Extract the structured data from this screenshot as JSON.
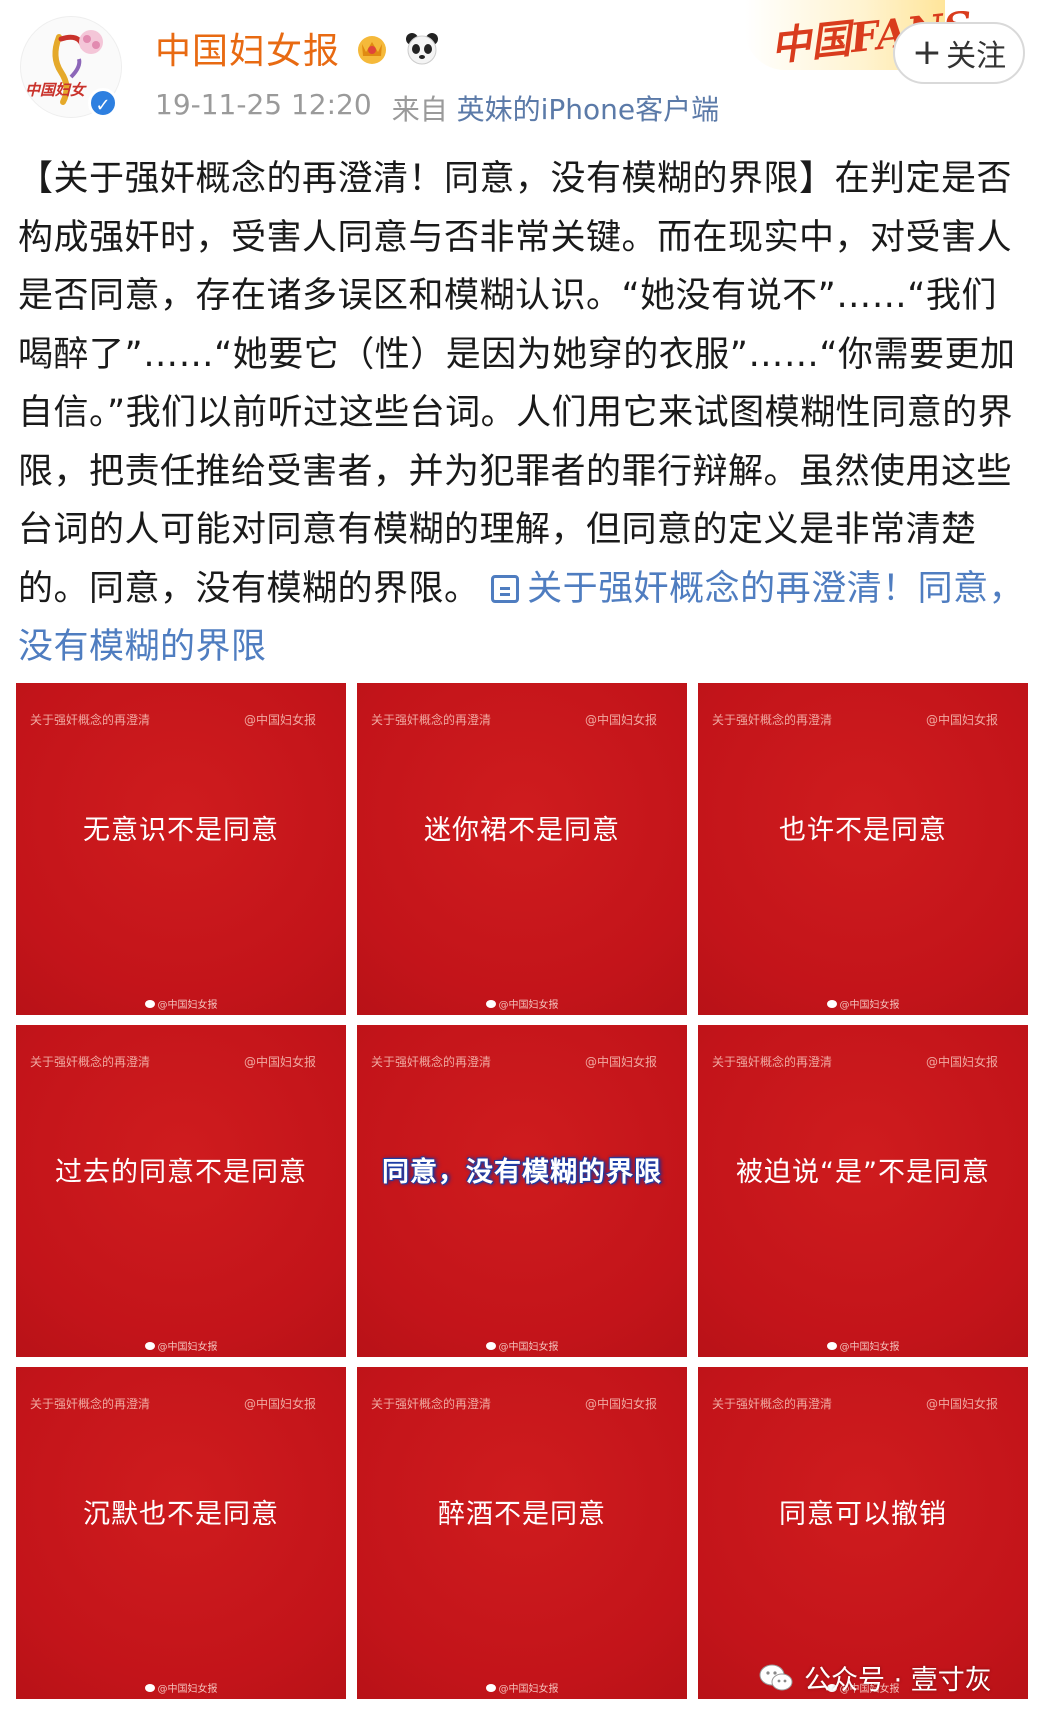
{
  "header": {
    "user_name": "中国妇女报",
    "timestamp": "19-11-25 12:20",
    "source_prefix": "来自",
    "source_app": "英妹的iPhone客户端",
    "follow_label": "关注",
    "follow_plus": "+",
    "fans_banner_text": "中国FANS",
    "avatar_text": "中国妇女",
    "verified_mark": "✓"
  },
  "post": {
    "text_main": "【关于强奸概念的再澄清！同意，没有模糊的界限】在判定是否构成强奸时，受害人同意与否非常关键。而在现实中，对受害人是否同意，存在诸多误区和模糊认识。“她没有说不”……“我们喝醉了”……“她要它（性）是因为她穿的衣服”……“你需要更加自信。”我们以前听过这些台词。人们用它来试图模糊性同意的界限，把责任推给受害者，并为犯罪者的罪行辩解。虽然使用这些台词的人可能对同意有模糊的理解，但同意的定义是非常清楚的。同意，没有模糊的界限。",
    "topic_link": "关于强奸概念的再澄清！同意，没有模糊的界限"
  },
  "tiles": [
    {
      "top_left": "关于强奸概念的再澄清",
      "top_right": "@中国妇女报",
      "main": "无意识不是同意",
      "bottom": "@中国妇女报"
    },
    {
      "top_left": "关于强奸概念的再澄清",
      "top_right": "@中国妇女报",
      "main": "迷你裙不是同意",
      "bottom": "@中国妇女报"
    },
    {
      "top_left": "关于强奸概念的再澄清",
      "top_right": "@中国妇女报",
      "main": "也许不是同意",
      "bottom": "@中国妇女报"
    },
    {
      "top_left": "关于强奸概念的再澄清",
      "top_right": "@中国妇女报",
      "main": "过去的同意不是同意",
      "bottom": "@中国妇女报"
    },
    {
      "top_left": "关于强奸概念的再澄清",
      "top_right": "@中国妇女报",
      "main": "同意，没有模糊的界限",
      "bottom": "@中国妇女报"
    },
    {
      "top_left": "关于强奸概念的再澄清",
      "top_right": "@中国妇女报",
      "main": "被迫说“是”不是同意",
      "bottom": "@中国妇女报"
    },
    {
      "top_left": "关于强奸概念的再澄清",
      "top_right": "@中国妇女报",
      "main": "沉默也不是同意",
      "bottom": "@中国妇女报"
    },
    {
      "top_left": "关于强奸概念的再澄清",
      "top_right": "@中国妇女报",
      "main": "醉酒不是同意",
      "bottom": "@中国妇女报"
    },
    {
      "top_left": "关于强奸概念的再澄清",
      "top_right": "@中国妇女报",
      "main": "同意可以撤销",
      "bottom": "@中国妇女报"
    }
  ],
  "watermark": {
    "text": "公众号 · 壹寸灰"
  },
  "colors": {
    "username": "#e86a12",
    "tile_red": "#c8171a",
    "link_blue": "#4f7dc0",
    "verified_blue": "#2d7fe0"
  },
  "icons": [
    "crown-badge-icon",
    "panda-icon",
    "verified-icon",
    "topic-icon",
    "wechat-icon",
    "weibo-icon"
  ]
}
